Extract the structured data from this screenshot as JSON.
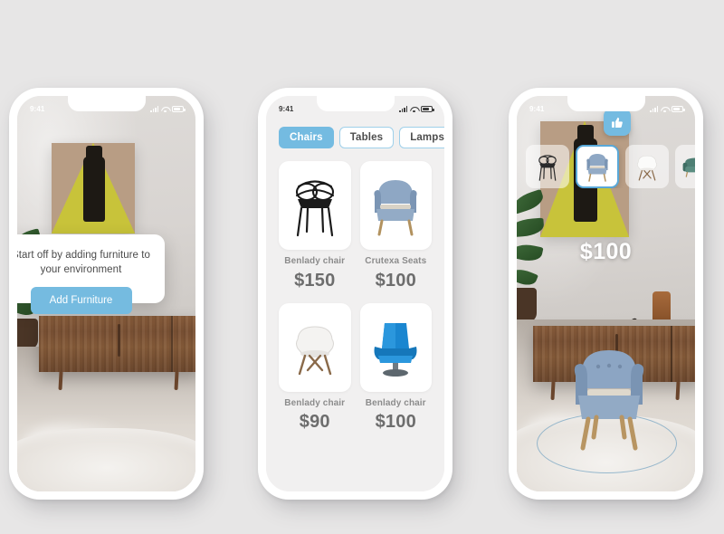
{
  "background_color": "#e7e6e6",
  "accent_color": "#74bbe1",
  "screens": [
    {
      "id": "ar-onboarding",
      "status_bar": {
        "time": "9:41",
        "signal_icon": "signal-bars-icon",
        "wifi_icon": "wifi-icon",
        "battery_icon": "battery-icon"
      },
      "tooltip": {
        "message": "Start off by adding furniture to your environment",
        "button_label": "Add Furniture"
      }
    },
    {
      "id": "catalog",
      "status_bar": {
        "time": "9:41",
        "signal_icon": "signal-bars-icon",
        "wifi_icon": "wifi-icon",
        "battery_icon": "battery-icon"
      },
      "tabs": [
        {
          "label": "Chairs",
          "active": true
        },
        {
          "label": "Tables",
          "active": false
        },
        {
          "label": "Lamps",
          "active": false
        }
      ],
      "products": [
        {
          "name": "Benlady chair",
          "price": "$150",
          "image": "black-wire-chair-icon"
        },
        {
          "name": "Crutexa Seats",
          "price": "$100",
          "image": "blue-armchair-icon"
        },
        {
          "name": "Benlady chair",
          "price": "$90",
          "image": "white-eames-chair-icon"
        },
        {
          "name": "Benlady chair",
          "price": "$100",
          "image": "blue-lounge-chair-icon"
        }
      ]
    },
    {
      "id": "ar-placement",
      "status_bar": {
        "time": "9:41",
        "signal_icon": "signal-bars-icon",
        "wifi_icon": "wifi-icon",
        "battery_icon": "battery-icon"
      },
      "like_button_icon": "thumbs-up-icon",
      "carousel": [
        {
          "image": "black-wire-chair-icon",
          "selected": false
        },
        {
          "image": "blue-armchair-icon",
          "selected": true
        },
        {
          "image": "white-eames-chair-icon",
          "selected": false
        },
        {
          "image": "green-sofa-icon",
          "selected": false
        }
      ],
      "price": "$100"
    }
  ]
}
